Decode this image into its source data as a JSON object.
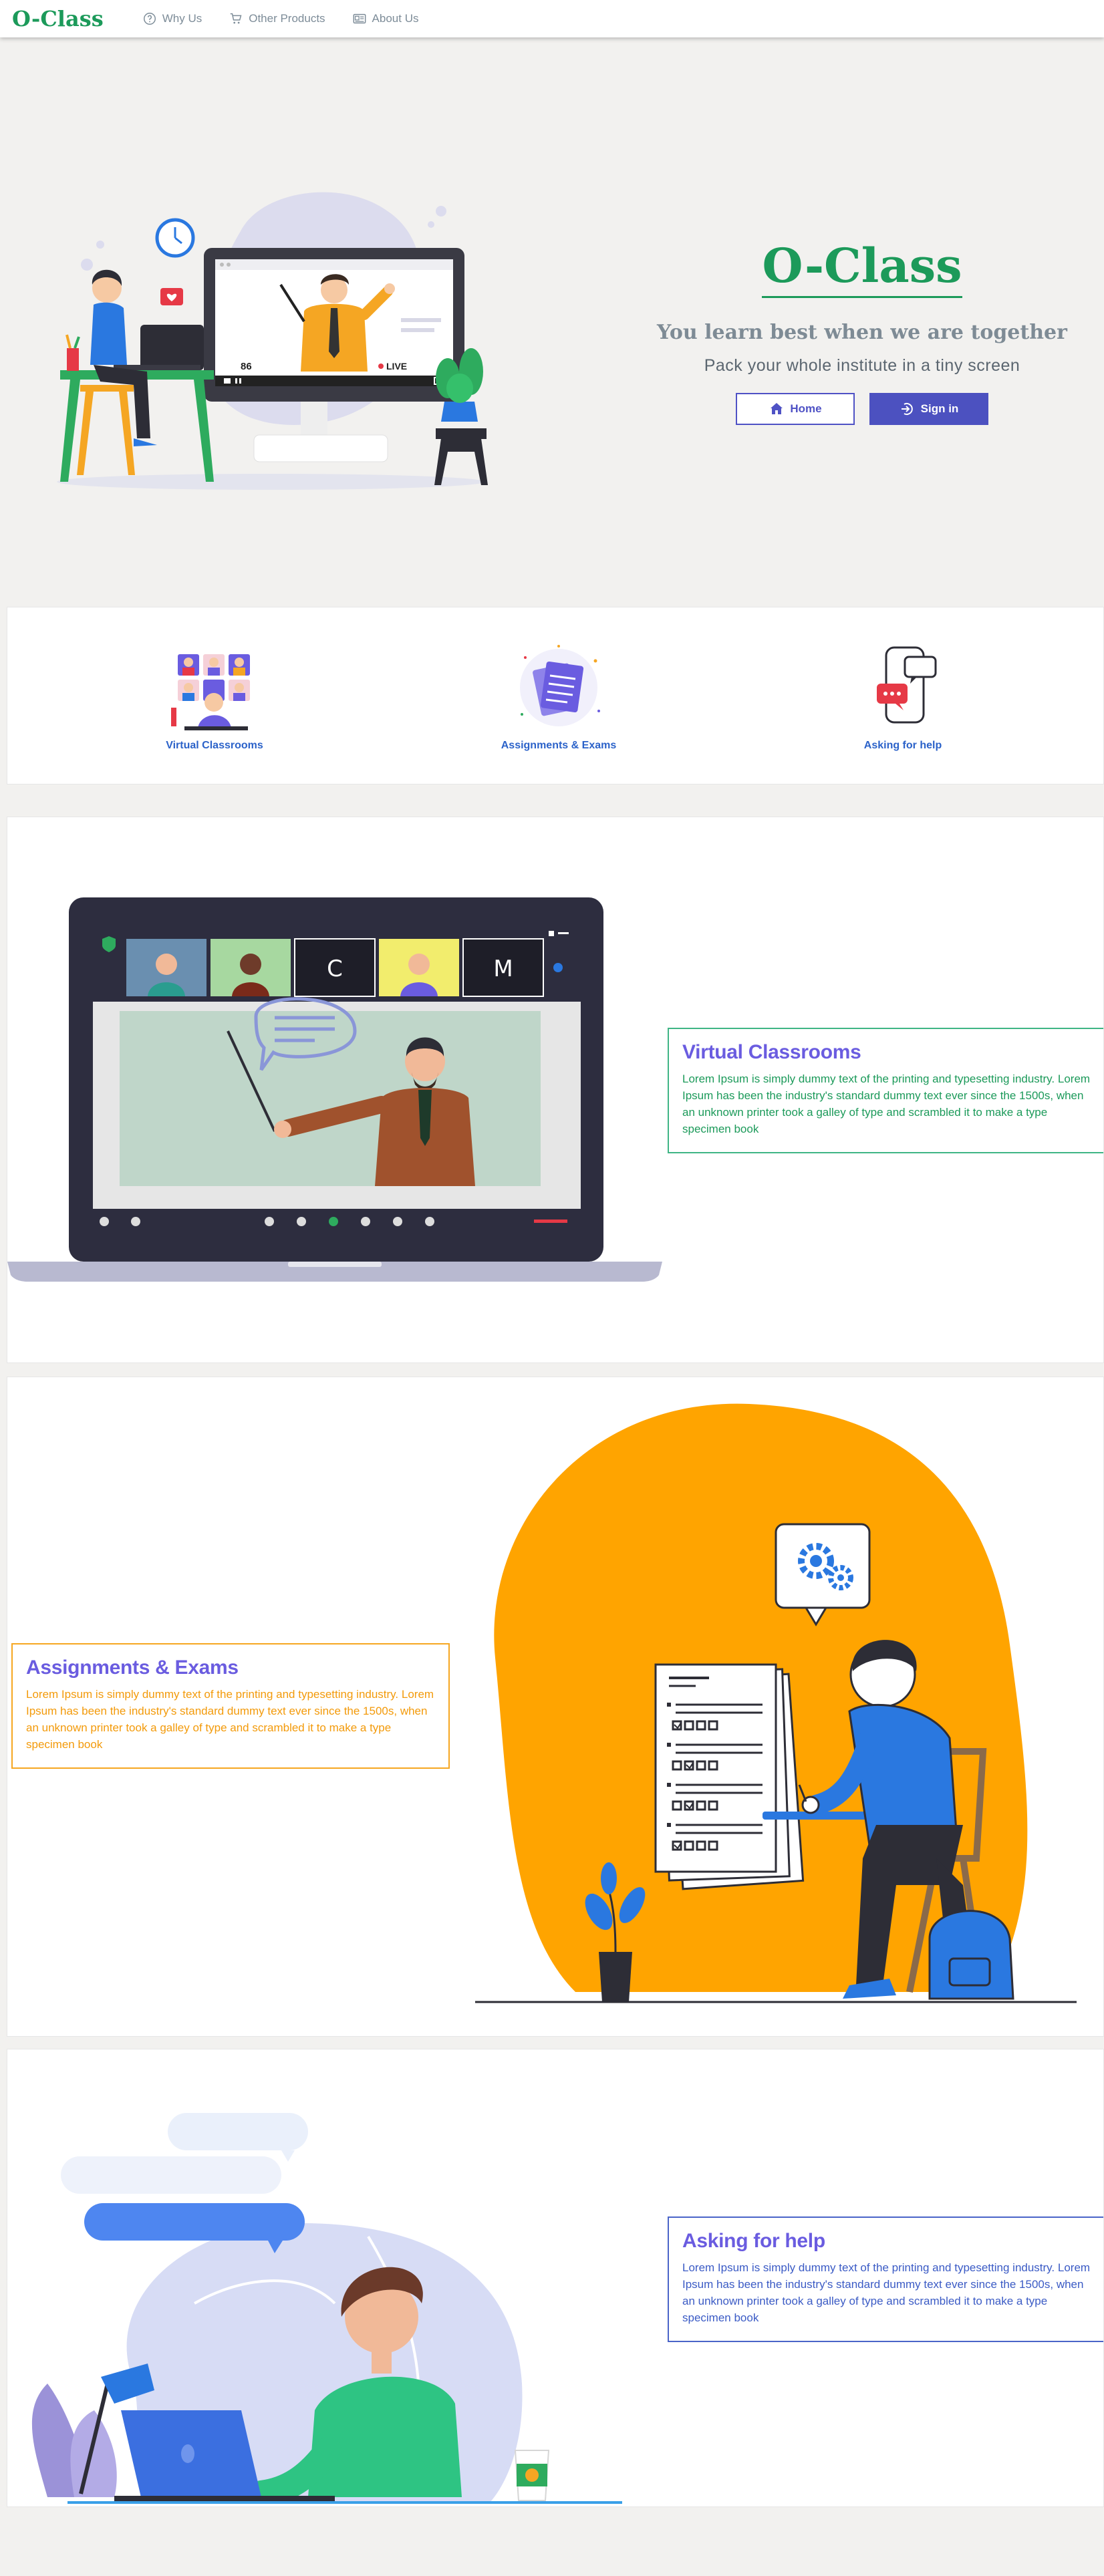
{
  "nav": {
    "brand": "O-Class",
    "links": [
      {
        "label": "Why Us",
        "icon": "question-circle-icon"
      },
      {
        "label": "Other Products",
        "icon": "cart-icon"
      },
      {
        "label": "About Us",
        "icon": "id-card-icon"
      }
    ]
  },
  "hero": {
    "title": "O-Class",
    "tagline": "You learn best when we are together",
    "subtitle": "Pack your whole institute in a tiny screen",
    "home_label": "Home",
    "signin_label": "Sign in",
    "illustration": {
      "viewer_count": "86",
      "live_label": "LIVE"
    }
  },
  "features": [
    {
      "label": "Virtual Classrooms",
      "icon": "video-call-grid-icon"
    },
    {
      "label": "Assignments & Exams",
      "icon": "documents-stack-icon"
    },
    {
      "label": "Asking for help",
      "icon": "chat-phone-icon"
    }
  ],
  "sections": [
    {
      "title": "Virtual Classrooms",
      "body": "Lorem Ipsum is simply dummy text of the printing and typesetting industry. Lorem Ipsum has been the industry's standard dummy text ever since the 1500s, when an unknown printer took a galley of type and scrambled it to make a type specimen book",
      "tiles": [
        "C",
        "M"
      ]
    },
    {
      "title": "Assignments & Exams",
      "body": "Lorem Ipsum is simply dummy text of the printing and typesetting industry. Lorem Ipsum has been the industry's standard dummy text ever since the 1500s, when an unknown printer took a galley of type and scrambled it to make a type specimen book"
    },
    {
      "title": "Asking for help",
      "body": "Lorem Ipsum is simply dummy text of the printing and typesetting industry. Lorem Ipsum has been the industry's standard dummy text ever since the 1500s, when an unknown printer took a galley of type and scrambled it to make a type specimen book"
    }
  ],
  "colors": {
    "brand_green": "#1c9a5a",
    "accent_purple": "#6a5ce0",
    "button_indigo": "#4c51c0",
    "orange": "#ffa400",
    "feature_blue": "#2b62c9"
  }
}
